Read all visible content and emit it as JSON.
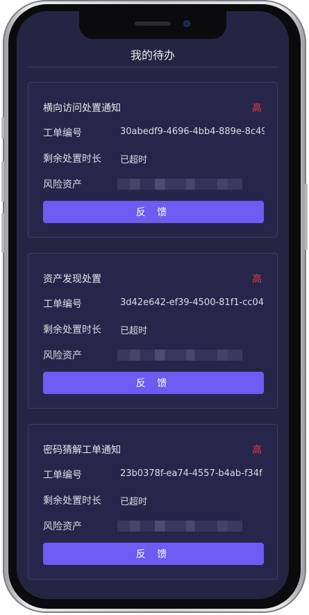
{
  "header": {
    "title": "我的待办"
  },
  "labels": {
    "work_order_no": "工单编号",
    "remaining_time": "剩余处置时长",
    "risk_asset": "风险资产"
  },
  "cards": [
    {
      "title": "横向访问处置通知",
      "priority": "高",
      "work_order_no": "30abedf9-4696-4bb4-889e-8c49",
      "remaining_time": "已超时",
      "feedback_label": "反 馈"
    },
    {
      "title": "资产发现处置",
      "priority": "高",
      "work_order_no": "3d42e642-ef39-4500-81f1-cc04",
      "remaining_time": "已超时",
      "feedback_label": "反 馈"
    },
    {
      "title": "密码猜解工单通知",
      "priority": "高",
      "work_order_no": "23b0378f-ea74-4557-b4ab-f34f",
      "remaining_time": "已超时",
      "feedback_label": "反 馈"
    }
  ],
  "colors": {
    "background": "#252543",
    "card_border": "#3c3d5e",
    "priority_high": "#e5364f",
    "button": "#6d5cf2"
  }
}
